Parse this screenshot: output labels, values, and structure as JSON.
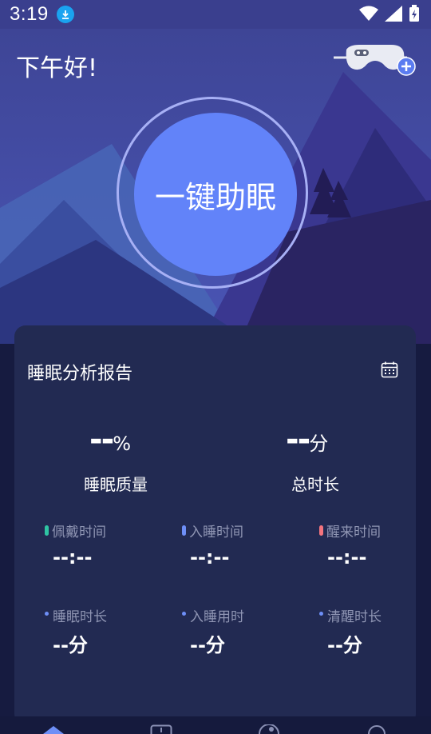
{
  "status_bar": {
    "time": "3:19"
  },
  "header": {
    "greeting": "下午好!"
  },
  "main_button": {
    "label": "一键助眠"
  },
  "report": {
    "title": "睡眠分析报告",
    "quality": {
      "value": "--",
      "unit": "%",
      "label": "睡眠质量"
    },
    "total": {
      "value": "--",
      "unit": "分",
      "label": "总时长"
    },
    "times": [
      {
        "label": "佩戴时间",
        "value": "--:--",
        "color": "#2fc4a3"
      },
      {
        "label": "入睡时间",
        "value": "--:--",
        "color": "#6e8ff7"
      },
      {
        "label": "醒来时间",
        "value": "--:--",
        "color": "#f4747e"
      }
    ],
    "durations": [
      {
        "label": "睡眠时长",
        "value": "--分"
      },
      {
        "label": "入睡用时",
        "value": "--分"
      },
      {
        "label": "清醒时长",
        "value": "--分"
      }
    ]
  }
}
